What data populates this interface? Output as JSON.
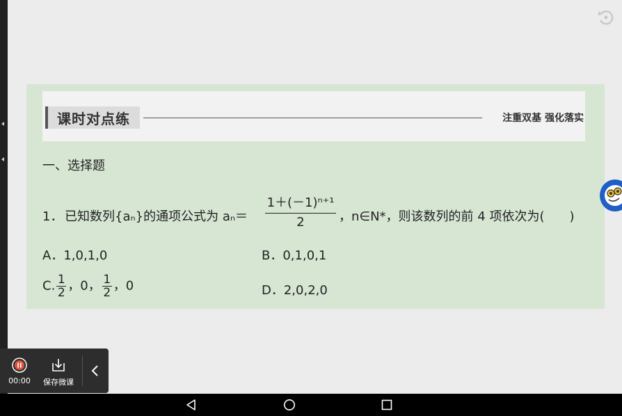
{
  "slide": {
    "title": "课时对点练",
    "slogan": "注重双基  强化落实",
    "section": "一、选择题",
    "question": {
      "number": "1．",
      "text_before": "已知数列{aₙ}的通项公式为 aₙ＝",
      "fraction_numerator": "1＋(－1)ⁿ⁺¹",
      "fraction_denominator": "2",
      "text_after": "，n∈N*，则该数列的前 4 项依次为(　　)"
    },
    "options": {
      "a": "A．1,0,1,0",
      "b": "B．0,1,0,1",
      "c_prefix": "C.",
      "c_frac_num": "1",
      "c_frac_den": "2",
      "c_mid": "，0，",
      "c_suffix": "，0",
      "d": "D．2,0,2,0"
    }
  },
  "recorder": {
    "timer": "00:00",
    "save_label": "保存微课",
    "status_color": "#e0533b"
  },
  "icons": {
    "undo": "undo-icon",
    "pause": "pause-icon",
    "save": "download-icon",
    "collapse": "chevron-left-icon",
    "assistant": "assistant-app-icon",
    "nav_back": "back-triangle-icon",
    "nav_home": "home-circle-icon",
    "nav_recent": "recent-square-icon"
  },
  "colors": {
    "slide_bg": "#d6e6d3",
    "header_band": "#f2f2f2",
    "assistant_blue": "#1f5fc6"
  }
}
